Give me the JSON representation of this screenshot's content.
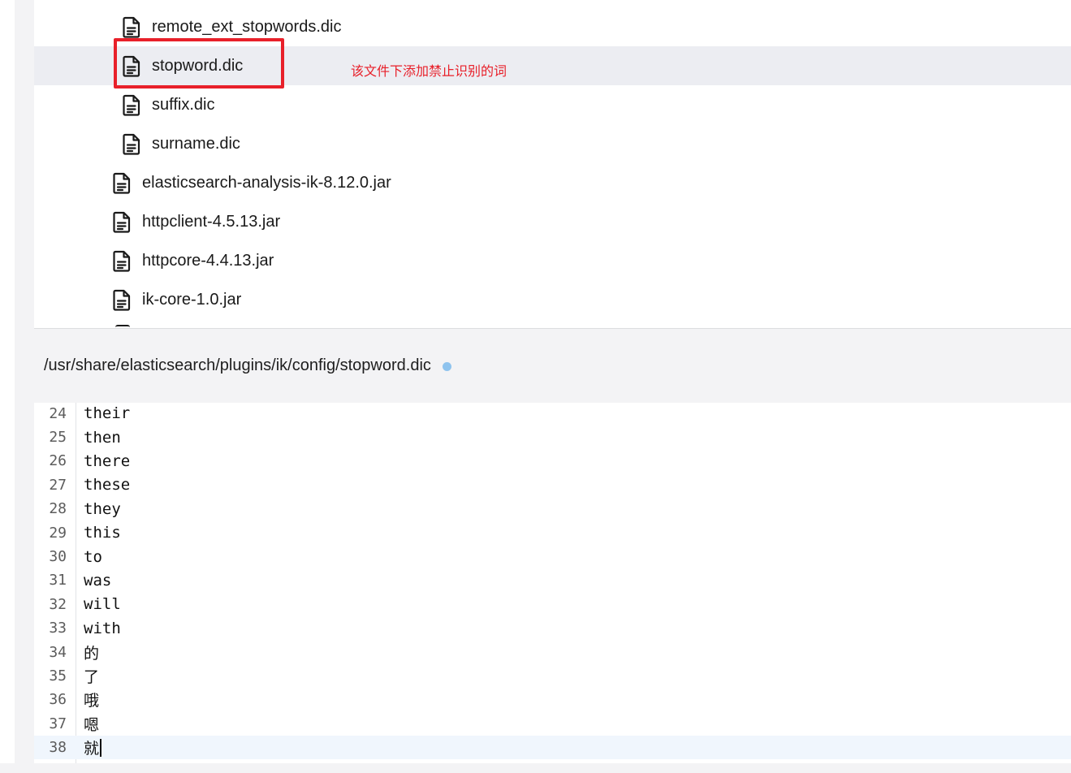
{
  "file_tree": {
    "items": [
      {
        "label": "remote_ext_stopwords.dic",
        "indent": 2,
        "selected": false,
        "icon": "file-icon"
      },
      {
        "label": "stopword.dic",
        "indent": 2,
        "selected": true,
        "icon": "file-icon"
      },
      {
        "label": "suffix.dic",
        "indent": 2,
        "selected": false,
        "icon": "file-icon"
      },
      {
        "label": "surname.dic",
        "indent": 2,
        "selected": false,
        "icon": "file-icon"
      },
      {
        "label": "elasticsearch-analysis-ik-8.12.0.jar",
        "indent": 1,
        "selected": false,
        "icon": "file-icon"
      },
      {
        "label": "httpclient-4.5.13.jar",
        "indent": 1,
        "selected": false,
        "icon": "file-icon"
      },
      {
        "label": "httpcore-4.4.13.jar",
        "indent": 1,
        "selected": false,
        "icon": "file-icon"
      },
      {
        "label": "ik-core-1.0.jar",
        "indent": 1,
        "selected": false,
        "icon": "file-icon"
      }
    ],
    "annotation": "该文件下添加禁止识别的词",
    "highlight_color": "#e8202a",
    "selected_bg": "#ecedf2"
  },
  "editor": {
    "path": "/usr/share/elasticsearch/plugins/ik/config/stopword.dic",
    "modified_indicator_color": "#8ec3ee",
    "active_line": 38,
    "lines": [
      {
        "num": "24",
        "text": "their"
      },
      {
        "num": "25",
        "text": "then"
      },
      {
        "num": "26",
        "text": "there"
      },
      {
        "num": "27",
        "text": "these"
      },
      {
        "num": "28",
        "text": "they"
      },
      {
        "num": "29",
        "text": "this"
      },
      {
        "num": "30",
        "text": "to"
      },
      {
        "num": "31",
        "text": "was"
      },
      {
        "num": "32",
        "text": "will"
      },
      {
        "num": "33",
        "text": "with"
      },
      {
        "num": "34",
        "text": "的"
      },
      {
        "num": "35",
        "text": "了"
      },
      {
        "num": "36",
        "text": "哦"
      },
      {
        "num": "37",
        "text": "嗯"
      },
      {
        "num": "38",
        "text": "就"
      }
    ]
  }
}
